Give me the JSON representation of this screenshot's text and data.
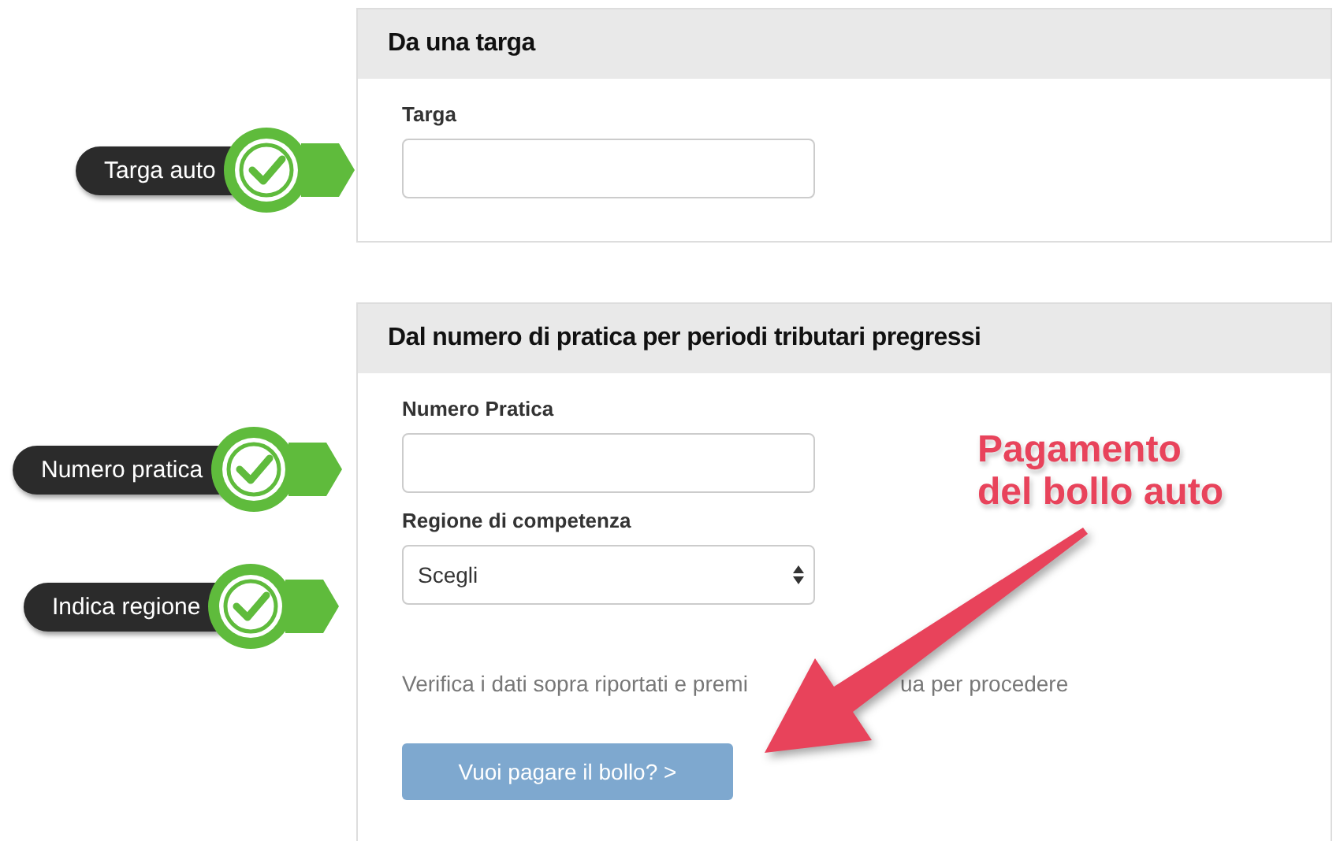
{
  "sections": [
    {
      "title": "Da una targa",
      "fields": [
        {
          "kind": "input",
          "label": "Targa"
        }
      ]
    },
    {
      "title": "Dal numero di pratica per periodi tributari pregressi",
      "fields": [
        {
          "kind": "input",
          "label": "Numero Pratica"
        },
        {
          "kind": "select",
          "label": "Regione di competenza",
          "value": "Scegli"
        }
      ],
      "note_parts": [
        "Verifica i dati sopra riportati e premi",
        "ua per procedere"
      ],
      "button": "Vuoi pagare il bollo? >"
    }
  ],
  "callouts": [
    {
      "text": "Targa auto"
    },
    {
      "text": "Numero pratica"
    },
    {
      "text": "Indica regione"
    }
  ],
  "annotation": {
    "lines": [
      "Pagamento",
      "del bollo auto"
    ]
  }
}
